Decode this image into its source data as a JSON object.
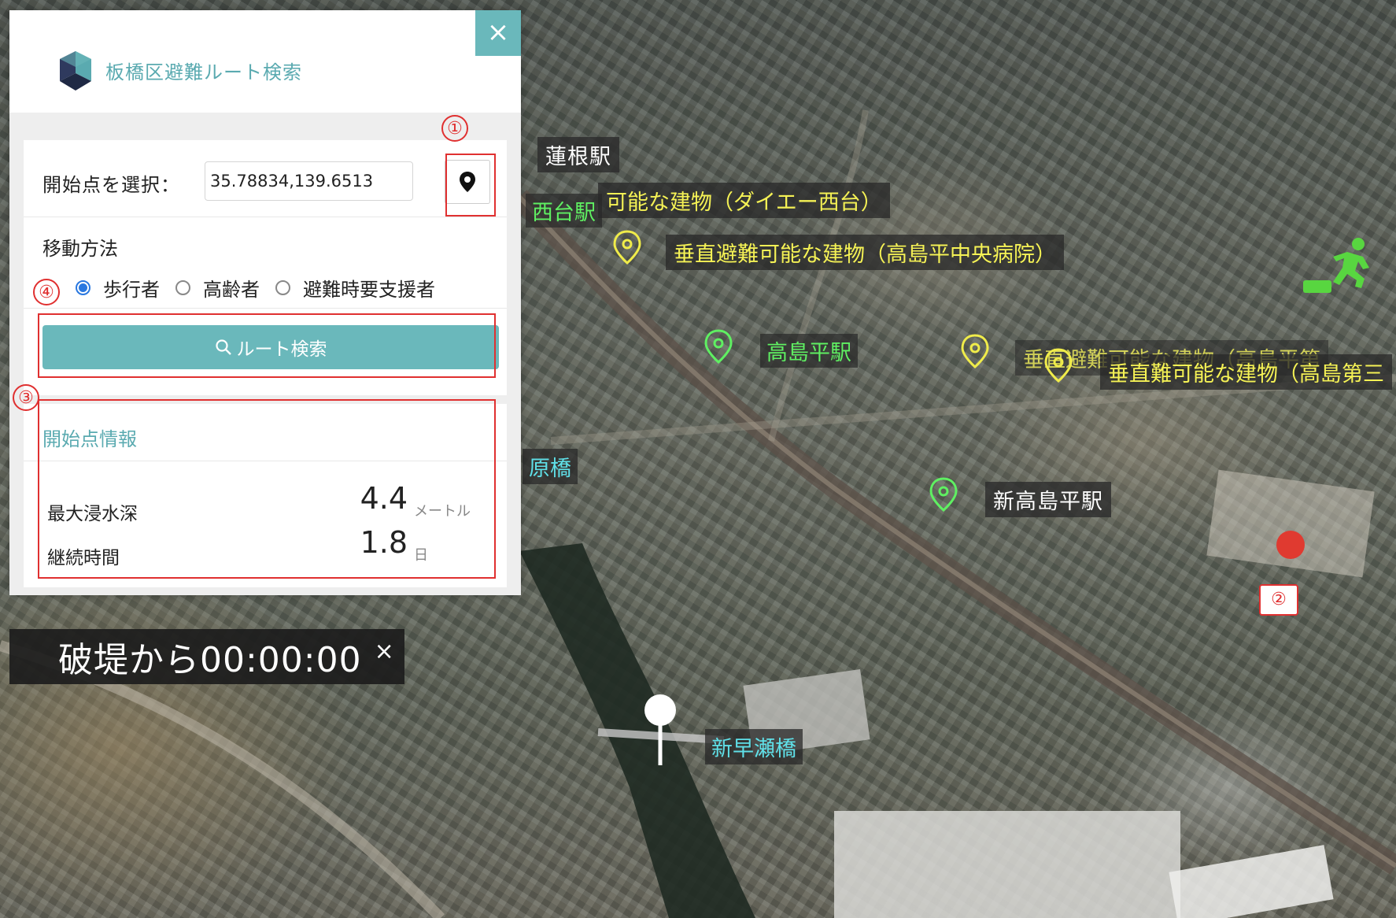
{
  "app": {
    "title": "板橋区避難ルート検索",
    "close_label": "×"
  },
  "form": {
    "start_label": "開始点を選択：",
    "start_value": "35.78834,139.6513",
    "move_label": "移動方法",
    "modes": [
      {
        "label": "歩行者",
        "selected": true
      },
      {
        "label": "高齢者",
        "selected": false
      },
      {
        "label": "避難時要支援者",
        "selected": false
      }
    ],
    "search_label": "ルート検索"
  },
  "info": {
    "title": "開始点情報",
    "depth_label": "最大浸水深",
    "depth_value": "4.4",
    "depth_unit": "メートル",
    "duration_label": "継続時間",
    "duration_value": "1.8",
    "duration_unit": "日"
  },
  "timer": {
    "text": "破堤から00:00:00",
    "close_label": "×"
  },
  "annotations": [
    "①",
    "②",
    "③",
    "④"
  ],
  "map_labels": {
    "hasune": "蓮根駅",
    "daiei_prefix": "垂直避難可能な建物",
    "daiei": "可能な建物（ダイエー西台）",
    "nishidai": "西台駅",
    "takashimadaira_hospital": "垂直避難可能な建物（高島平中央病院）",
    "takashimadaira": "高島平駅",
    "vertical_partial": "垂直避難可能な建物（高島平第",
    "vertical_third": "垂直難可能な建物（高島第三",
    "harabashi": "原橋",
    "shin_takashimadaira": "新高島平駅",
    "shin_hayasebashi": "新早瀬橋"
  },
  "colors": {
    "accent": "#6ab8bb",
    "annotation": "#e03030",
    "radio": "#2a78e0"
  }
}
